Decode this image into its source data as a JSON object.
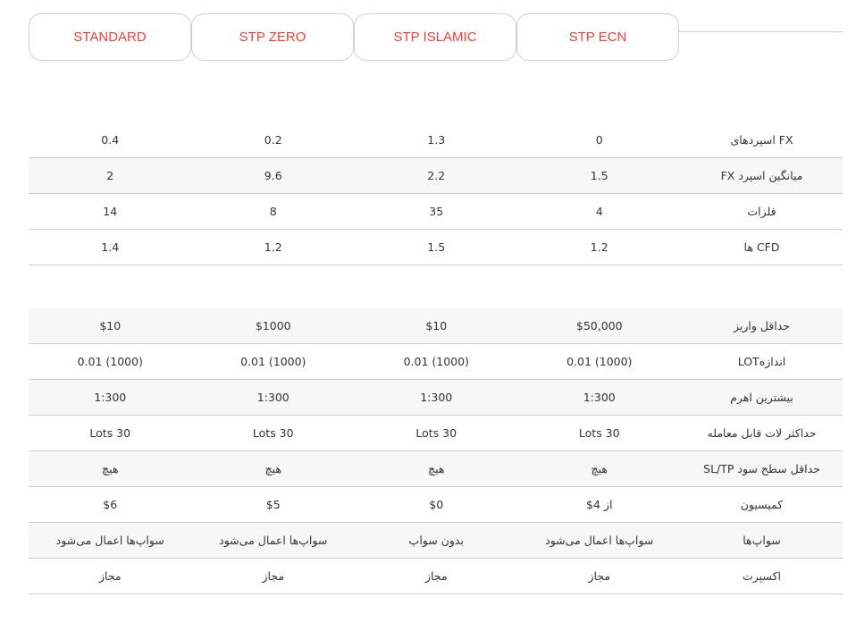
{
  "tabs": [
    "STANDARD",
    "STP ZERO",
    "STP ISLAMIC",
    "STP ECN"
  ],
  "table1": [
    {
      "label": "FX اسپردهای",
      "values": [
        "0.4",
        "0.2",
        "1.3",
        "0"
      ]
    },
    {
      "label": "میانگین اسپرد FX",
      "values": [
        "2",
        "9.6",
        "2.2",
        "1.5"
      ]
    },
    {
      "label": "فلزات",
      "values": [
        "14",
        "8",
        "35",
        "4"
      ]
    },
    {
      "label": "CFD ها",
      "values": [
        "1.4",
        "1.2",
        "1.5",
        "1.2"
      ]
    }
  ],
  "table2": [
    {
      "label": "حداقل واریز",
      "values": [
        "$10",
        "$1000",
        "$10",
        "$50,000"
      ]
    },
    {
      "label": "اندازهLOT",
      "values": [
        "0.01 (1000)",
        "0.01 (1000)",
        "0.01 (1000)",
        "0.01 (1000)"
      ]
    },
    {
      "label": "بیشترین اهرم",
      "values": [
        "1:300",
        "1:300",
        "1:300",
        "1:300"
      ]
    },
    {
      "label": "حداکثر لات قابل معامله",
      "values": [
        "Lots 30",
        "Lots 30",
        "Lots 30",
        "Lots 30"
      ]
    },
    {
      "label": "حداقل سطح سود SL/TP",
      "values": [
        "هیچ",
        "هیچ",
        "هیچ",
        "هیچ"
      ]
    },
    {
      "label": "کمیسیون",
      "values": [
        "$6",
        "$5",
        "$0",
        "از 4$"
      ]
    },
    {
      "label": "سواپ‌ها",
      "values": [
        "سواپ‌ها اعمال می‌شود",
        "سواپ‌ها اعمال می‌شود",
        "بدون سواپ",
        "سواپ‌ها اعمال می‌شود"
      ]
    },
    {
      "label": "اکسپرت",
      "values": [
        "مجاز",
        "مجاز",
        "مجاز",
        "مجاز"
      ]
    }
  ]
}
